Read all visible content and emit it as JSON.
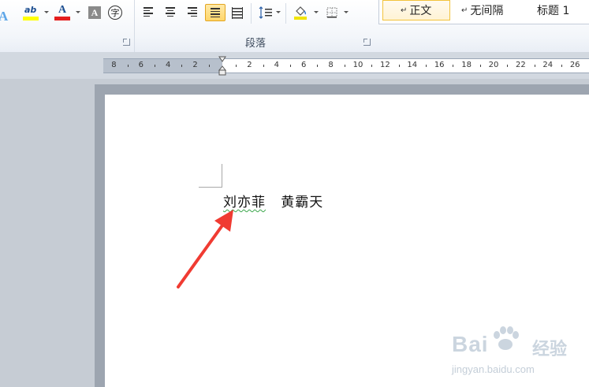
{
  "ribbon": {
    "font_group": {
      "text_effect_icon": "A",
      "highlight_icon": "ab",
      "font_color_icon": "A",
      "char_shading_icon": "A",
      "enclosed_char_icon": "字"
    },
    "paragraph_group": {
      "label": "段落"
    },
    "styles": [
      {
        "label": "正文",
        "active": true
      },
      {
        "label": "无间隔",
        "active": false
      },
      {
        "label": "标题 1",
        "active": false
      }
    ],
    "para_mark": "↵"
  },
  "ruler": {
    "left_numbers": [
      "8",
      "6",
      "4",
      "2"
    ],
    "right_numbers": [
      "2",
      "4",
      "6",
      "8",
      "10",
      "12",
      "14",
      "16",
      "18",
      "20",
      "22",
      "24",
      "26"
    ]
  },
  "document": {
    "name1": "刘亦菲",
    "name2": "黄霸天"
  },
  "watermark": {
    "brand": "Bai",
    "brand_cn": "经验",
    "url": "jingyan.baidu.com"
  },
  "colors": {
    "highlight_yellow": "#ffff00",
    "font_red": "#e41e1e",
    "arrow_red": "#f03b32",
    "active_button": "#ffd66a"
  }
}
